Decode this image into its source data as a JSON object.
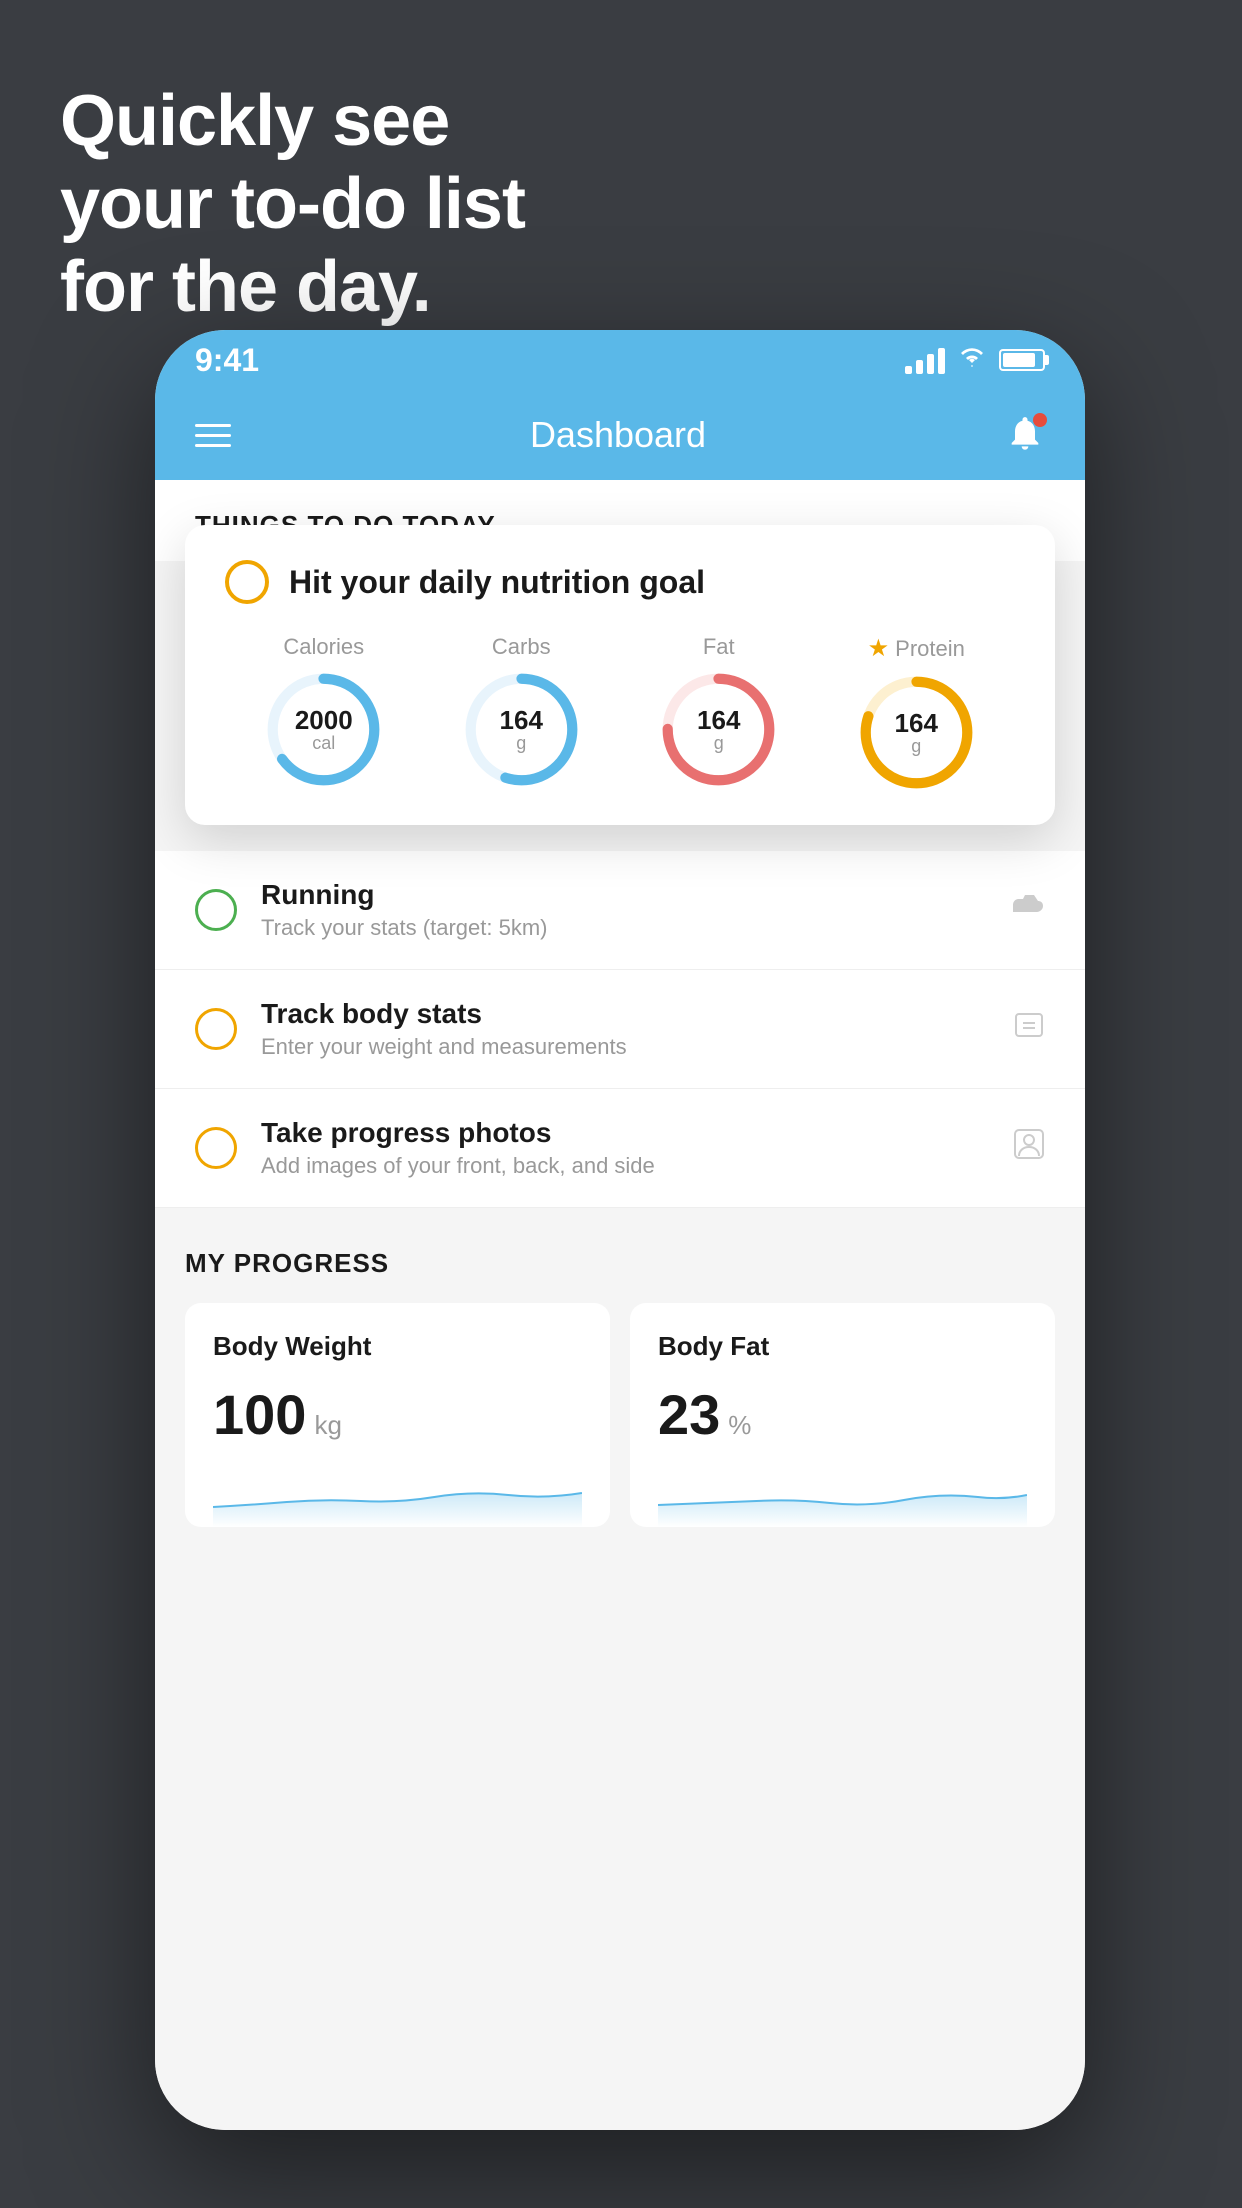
{
  "headline": {
    "line1": "Quickly see",
    "line2": "your to-do list",
    "line3": "for the day."
  },
  "status_bar": {
    "time": "9:41"
  },
  "header": {
    "title": "Dashboard"
  },
  "things_section": {
    "title": "THINGS TO DO TODAY"
  },
  "nutrition_card": {
    "title": "Hit your daily nutrition goal",
    "items": [
      {
        "label": "Calories",
        "value": "2000",
        "unit": "cal",
        "color": "#5ab8e8",
        "percent": 65
      },
      {
        "label": "Carbs",
        "value": "164",
        "unit": "g",
        "color": "#5ab8e8",
        "percent": 55
      },
      {
        "label": "Fat",
        "value": "164",
        "unit": "g",
        "color": "#e87070",
        "percent": 75
      },
      {
        "label": "Protein",
        "value": "164",
        "unit": "g",
        "color": "#f0a500",
        "percent": 80,
        "starred": true
      }
    ]
  },
  "todo_items": [
    {
      "circle_color": "green",
      "title": "Running",
      "subtitle": "Track your stats (target: 5km)",
      "icon": "shoe"
    },
    {
      "circle_color": "yellow",
      "title": "Track body stats",
      "subtitle": "Enter your weight and measurements",
      "icon": "scale"
    },
    {
      "circle_color": "yellow",
      "title": "Take progress photos",
      "subtitle": "Add images of your front, back, and side",
      "icon": "person"
    }
  ],
  "progress_section": {
    "title": "MY PROGRESS",
    "cards": [
      {
        "title": "Body Weight",
        "value": "100",
        "unit": "kg"
      },
      {
        "title": "Body Fat",
        "value": "23",
        "unit": "%"
      }
    ]
  }
}
